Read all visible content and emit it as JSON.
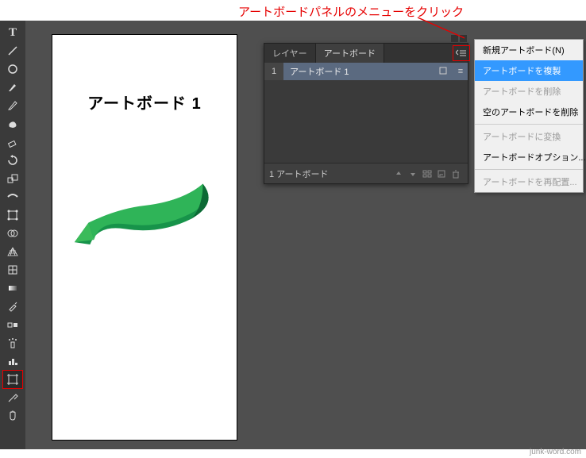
{
  "annotation": {
    "text": "アートボードパネルのメニューをクリック"
  },
  "toolbar": {
    "tools": [
      "type",
      "line",
      "ellipse",
      "paintbrush",
      "pencil",
      "blob",
      "eraser",
      "rotate",
      "scale",
      "width",
      "free-transform",
      "shape-builder",
      "perspective-grid",
      "mesh",
      "gradient",
      "eyedropper",
      "blend",
      "symbol-sprayer",
      "column-graph",
      "artboard",
      "slice",
      "hand"
    ]
  },
  "canvas": {
    "title": "アートボード 1"
  },
  "panel": {
    "tabs": [
      {
        "label": "レイヤー",
        "active": false
      },
      {
        "label": "アートボード",
        "active": true
      }
    ],
    "rows": [
      {
        "index": "1",
        "name": "アートボード 1"
      }
    ],
    "footer_count": "1 アートボード"
  },
  "flyout": {
    "items": [
      {
        "label": "新規アートボード(N)",
        "state": "normal"
      },
      {
        "label": "アートボードを複製",
        "state": "highlight"
      },
      {
        "label": "アートボードを削除",
        "state": "disabled"
      },
      {
        "label": "空のアートボードを削除",
        "state": "normal"
      },
      {
        "sep": true
      },
      {
        "label": "アートボードに変換",
        "state": "disabled"
      },
      {
        "label": "アートボードオプション...",
        "state": "normal"
      },
      {
        "sep": true
      },
      {
        "label": "アートボードを再配置...",
        "state": "disabled"
      }
    ]
  },
  "watermark": "junk-word.com"
}
